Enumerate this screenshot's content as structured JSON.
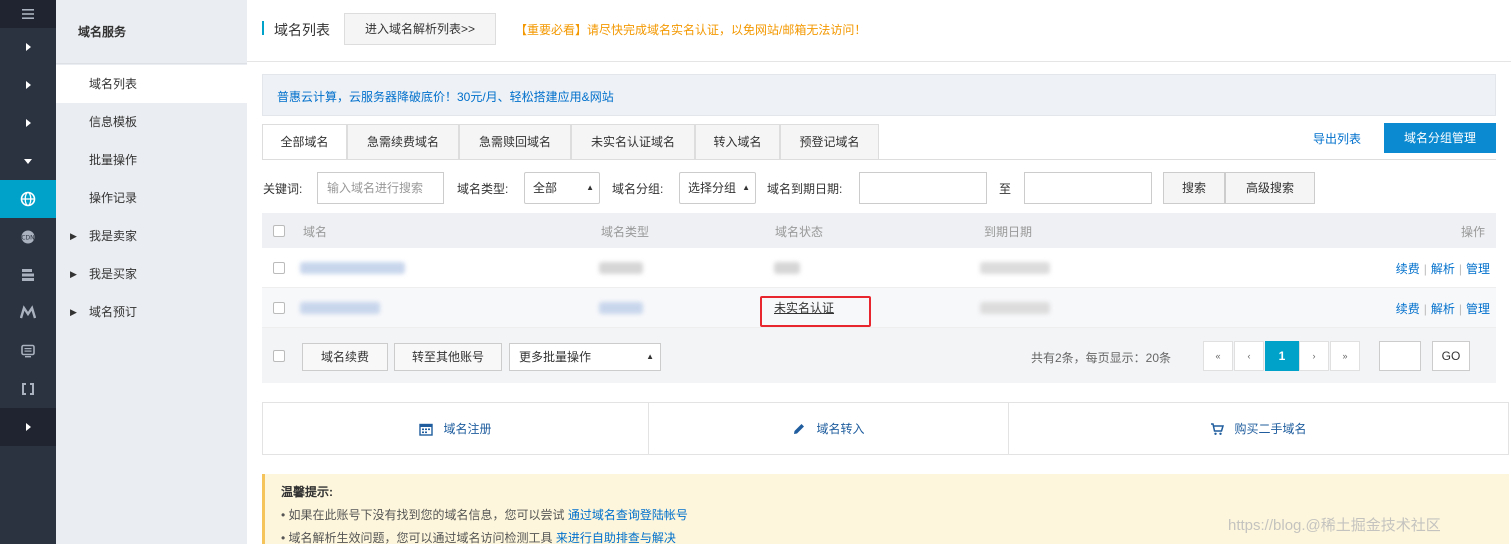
{
  "rail": {
    "items": [
      {
        "icon": "menu-icon"
      },
      {
        "icon": "chevron-right-icon"
      },
      {
        "icon": "chevron-right-icon"
      },
      {
        "icon": "chevron-right-icon"
      },
      {
        "icon": "chevron-down-icon"
      },
      {
        "icon": "globe-icon"
      },
      {
        "icon": "cdn-icon"
      },
      {
        "icon": "server-stack-icon"
      },
      {
        "icon": "m-logo-icon"
      },
      {
        "icon": "monitor-icon"
      },
      {
        "icon": "bracket-icon"
      },
      {
        "icon": "chevron-right-icon"
      }
    ]
  },
  "subnav": {
    "title": "域名服务",
    "items": [
      {
        "label": "域名列表",
        "active": true
      },
      {
        "label": "信息模板"
      },
      {
        "label": "批量操作"
      },
      {
        "label": "操作记录"
      },
      {
        "label": "我是卖家",
        "expandable": true
      },
      {
        "label": "我是买家",
        "expandable": true
      },
      {
        "label": "域名预订",
        "expandable": true
      }
    ]
  },
  "header": {
    "title": "域名列表",
    "dns_button": "进入域名解析列表>>",
    "notice": "【重要必看】请尽快完成域名实名认证，以免网站/邮箱无法访问！"
  },
  "promo": "普惠云计算，云服务器降破底价！30元/月、轻松搭建应用&网站",
  "tabs": [
    "全部域名",
    "急需续费域名",
    "急需赎回域名",
    "未实名认证域名",
    "转入域名",
    "预登记域名"
  ],
  "toolbar": {
    "export": "导出列表",
    "group_manage": "域名分组管理"
  },
  "filter": {
    "keyword_label": "关键词:",
    "keyword_placeholder": "输入域名进行搜索",
    "type_label": "域名类型:",
    "type_value": "全部",
    "group_label": "域名分组:",
    "group_value": "选择分组",
    "expire_label": "域名到期日期:",
    "to_label": "至",
    "search": "搜索",
    "advanced": "高级搜索"
  },
  "table": {
    "headers": {
      "domain": "域名",
      "type": "域名类型",
      "status": "域名状态",
      "expire": "到期日期",
      "ops": "操作"
    },
    "rows": [
      {
        "status": "",
        "ops": [
          "续费",
          "解析",
          "管理"
        ]
      },
      {
        "status": "未实名认证",
        "ops": [
          "续费",
          "解析",
          "管理"
        ]
      }
    ]
  },
  "footer": {
    "renew": "域名续费",
    "transfer": "转至其他账号",
    "more_batch": "更多批量操作",
    "summary": "共有2条，每页显示：20条",
    "current_page": "1",
    "go": "GO"
  },
  "actions": [
    "域名注册",
    "域名转入",
    "购买二手域名"
  ],
  "tips": {
    "title": "温馨提示:",
    "line1_text": "• 如果在此账号下没有找到您的域名信息，您可以尝试",
    "line1_link": "通过域名查询登陆帐号",
    "line2_text": "• 域名解析生效问题，您可以通过域名访问检测工具",
    "line2_link": "来进行自助排查与解决"
  },
  "watermark": "https://blog.@稀土掘金技术社区"
}
